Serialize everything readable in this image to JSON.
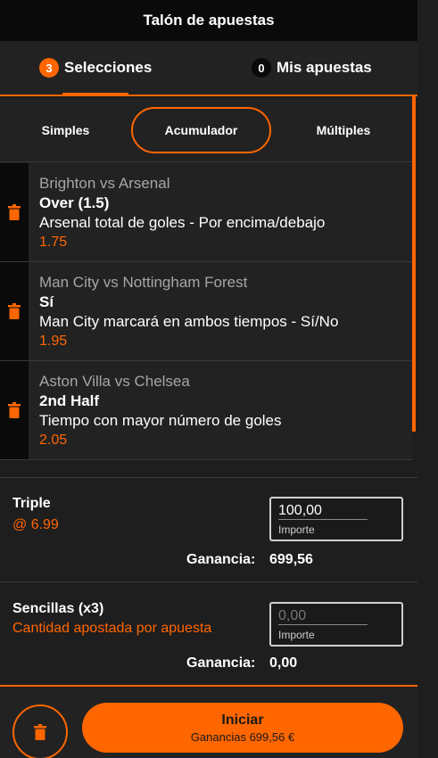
{
  "header": {
    "title": "Talón de apuestas"
  },
  "tabs": [
    {
      "count": "3",
      "label": "Selecciones"
    },
    {
      "count": "0",
      "label": "Mis apuestas"
    }
  ],
  "bet_types": {
    "simples": "Simples",
    "acumulador": "Acumulador",
    "multiples": "Múltiples"
  },
  "selections": [
    {
      "match": "Brighton vs Arsenal",
      "pick": "Over (1.5)",
      "market": "Arsenal total de goles - Por encima/debajo",
      "odds": "1.75"
    },
    {
      "match": "Man City vs Nottingham Forest",
      "pick": "Sí",
      "market": "Man City marcará en ambos tiempos - Sí/No",
      "odds": "1.95"
    },
    {
      "match": "Aston Villa vs Chelsea",
      "pick": "2nd Half",
      "market": "Tiempo con mayor número de goles",
      "odds": "2.05"
    }
  ],
  "triple": {
    "label": "Triple",
    "odds": "@ 6.99",
    "stake_value": "100,00",
    "stake_label": "Importe",
    "gain_label": "Ganancia:",
    "gain_value": "699,56"
  },
  "singles": {
    "label": "Sencillas (x3)",
    "sub": "Cantidad apostada por apuesta",
    "stake_placeholder": "0,00",
    "stake_label": "Importe",
    "gain_label": "Ganancia:",
    "gain_value": "0,00"
  },
  "footer": {
    "start_label": "Iniciar",
    "winnings": "Ganancias 699,56 €"
  },
  "colors": {
    "accent": "#ff6600",
    "background": "#222222",
    "dark": "#0a0a0a"
  },
  "icons": {
    "delete": "trash-icon"
  }
}
